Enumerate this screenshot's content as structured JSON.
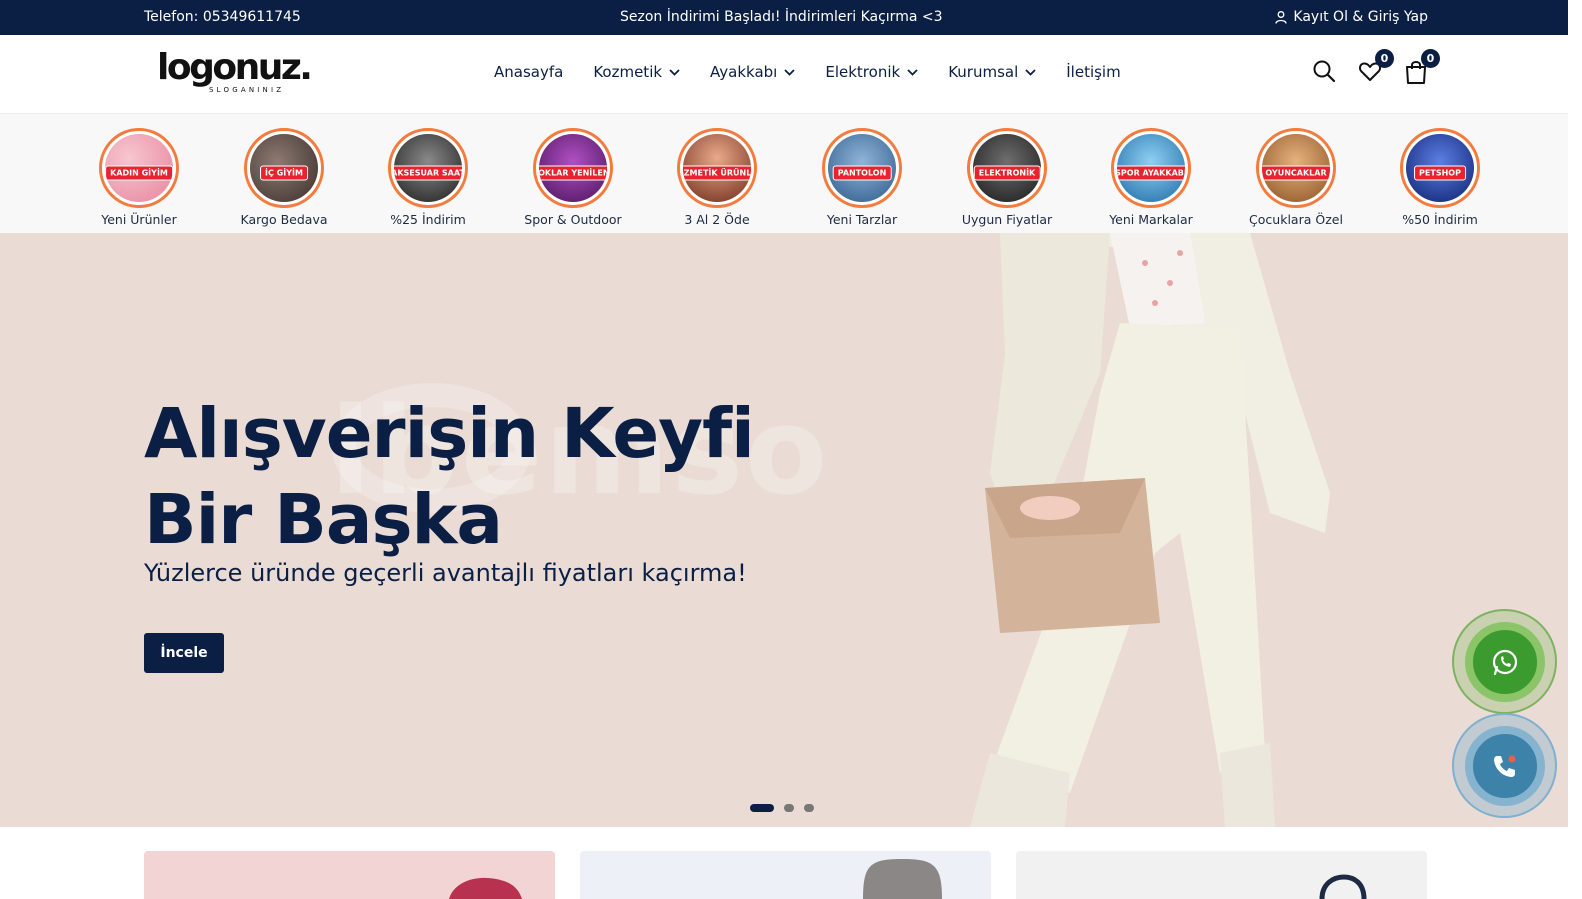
{
  "topbar": {
    "phone": "Telefon: 05349611745",
    "promo": "Sezon İndirimi Başladı! İndirimleri Kaçırma <3",
    "login": "Kayıt Ol & Giriş Yap"
  },
  "header": {
    "logo_text": "logonuz.",
    "logo_slogan": "SLOGANINIZ",
    "nav": [
      {
        "label": "Anasayfa",
        "has_dropdown": false
      },
      {
        "label": "Kozmetik",
        "has_dropdown": true
      },
      {
        "label": "Ayakkabı",
        "has_dropdown": true
      },
      {
        "label": "Elektronik",
        "has_dropdown": true
      },
      {
        "label": "Kurumsal",
        "has_dropdown": true
      },
      {
        "label": "İletişim",
        "has_dropdown": false
      }
    ],
    "icons": [
      "search-icon",
      "heart-icon",
      "shopping-bag-icon"
    ],
    "wishlist_count": "0",
    "cart_count": "0"
  },
  "stories": [
    {
      "tag": "KADIN GİYİM",
      "label": "Yeni Ürünler",
      "color": "#f3a3b8"
    },
    {
      "tag": "İÇ GİYİM",
      "label": "Kargo Bedava",
      "color": "#5a4a44"
    },
    {
      "tag": "AKSESUAR SAAT",
      "label": "%25 İndirim",
      "color": "#3b3b3b"
    },
    {
      "tag": "STOKLAR YENİLENDİ",
      "label": "Spor & Outdoor",
      "color": "#7a2f8f"
    },
    {
      "tag": "KOZMETİK ÜRÜNLER",
      "label": "3 Al 2 Öde",
      "color": "#b85a3c"
    },
    {
      "tag": "PANTOLON",
      "label": "Yeni Tarzlar",
      "color": "#4e7fb0"
    },
    {
      "tag": "ELEKTRONİK",
      "label": "Uygun Fiyatlar",
      "color": "#3a3a3a"
    },
    {
      "tag": "SPOR AYAKKABI",
      "label": "Yeni Markalar",
      "color": "#2f8fcf"
    },
    {
      "tag": "OYUNCAKLAR",
      "label": "Çocuklara Özel",
      "color": "#c8874a"
    },
    {
      "tag": "PETSHOP",
      "label": "%50 İndirim",
      "color": "#1f3fa0"
    }
  ],
  "hero": {
    "title_line1": "Alışverişin Keyfi",
    "title_line2": "Bir Başka",
    "subtitle": "Yüzlerce üründe geçerli avantajlı fiyatları kaçırma!",
    "cta": "İncele",
    "watermark": "ibemso",
    "slides": 3,
    "active_slide": 1
  },
  "floating": {
    "whatsapp_icon": "whatsapp-icon",
    "phone_icon": "phone-call-icon"
  },
  "cards": [
    {
      "color": "#f2d4d4"
    },
    {
      "color": "#eef0f8"
    },
    {
      "color": "#f1f1f1"
    }
  ],
  "colors": {
    "primary": "#0b1f44",
    "hero_bg": "#eadcd5",
    "story_ring": "#f37b3d",
    "whatsapp": "#3b9b2f",
    "call": "#3d82a8"
  }
}
